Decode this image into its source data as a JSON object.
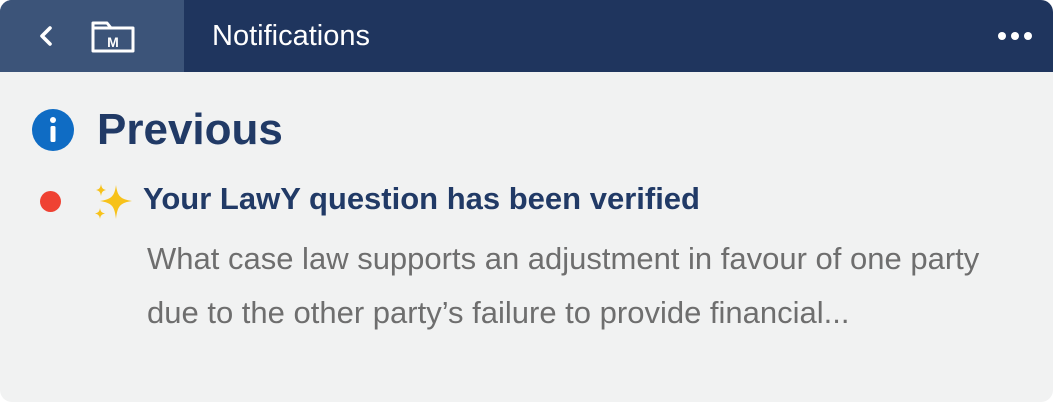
{
  "header": {
    "title": "Notifications",
    "back_icon": "chevron-left-icon",
    "folder_icon": "folder-m-icon",
    "folder_badge": "M",
    "more_icon": "more-horizontal-icon"
  },
  "section": {
    "icon": "info-icon",
    "title": "Previous"
  },
  "notifications": [
    {
      "unread": true,
      "icon": "sparkles-icon",
      "title": "Your LawY question has been verified",
      "body": "What case law supports an adjustment in favour of one party due to the other party’s failure to provide financial..."
    }
  ],
  "colors": {
    "header_bg": "#1f355e",
    "nav_block_bg": "#3c5479",
    "panel_bg": "#f1f2f2",
    "title_text": "#213a66",
    "info_blue": "#0f6cc4",
    "unread_dot": "#ef4233",
    "body_text": "#6e6e6e",
    "sparkle": "#f7c21a"
  }
}
